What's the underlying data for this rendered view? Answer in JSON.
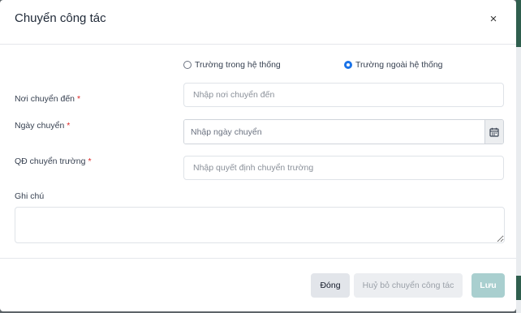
{
  "dialog": {
    "title": "Chuyển công tác",
    "close_label": "×"
  },
  "transfer_type": {
    "options": [
      {
        "label": "Trường trong hệ thống",
        "checked": false
      },
      {
        "label": "Trường ngoài hệ thống",
        "checked": true
      }
    ]
  },
  "form": {
    "destination": {
      "label": "Nơi chuyển đến",
      "required": "*",
      "placeholder": "Nhập nơi chuyển đến",
      "value": ""
    },
    "transfer_date": {
      "label": "Ngày chuyển",
      "required": "*",
      "placeholder": "Nhập ngày chuyển",
      "value": "",
      "icon": "calendar-icon"
    },
    "decision": {
      "label": "QĐ chuyển trường",
      "required": "*",
      "placeholder": "Nhập quyết định chuyển trường",
      "value": ""
    },
    "note": {
      "label": "Ghi chú",
      "value": ""
    }
  },
  "footer": {
    "close_label": "Đóng",
    "cancel_transfer_label": "Huỷ bỏ chuyển công tác",
    "save_label": "Lưu"
  },
  "colors": {
    "accent": "#1a73e8",
    "required": "#dc2626",
    "save_button": "#a9cfcf"
  }
}
